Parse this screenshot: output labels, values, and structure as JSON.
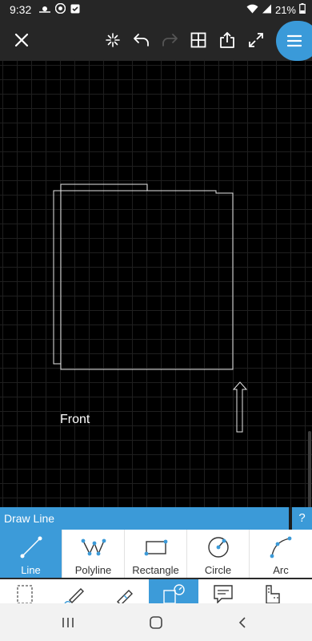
{
  "status_bar": {
    "time": "9:32",
    "battery": "21%",
    "left_icons": [
      "weather-icon",
      "chrome-icon",
      "download-icon"
    ],
    "right_icons": [
      "wifi-icon",
      "signal-icon",
      "battery-icon"
    ]
  },
  "toolbar": {
    "buttons": [
      "close-icon",
      "snap-icon",
      "undo-icon",
      "redo-icon",
      "grid-icon",
      "share-icon",
      "fullscreen-icon",
      "menu-icon"
    ]
  },
  "canvas": {
    "label": "Front"
  },
  "draw_panel": {
    "title": "Draw Line",
    "help": "?"
  },
  "tools": [
    {
      "label": "Line",
      "icon": "line-icon",
      "selected": true
    },
    {
      "label": "Polyline",
      "icon": "polyline-icon",
      "selected": false
    },
    {
      "label": "Rectangle",
      "icon": "rectangle-icon",
      "selected": false
    },
    {
      "label": "Circle",
      "icon": "circle-icon",
      "selected": false
    },
    {
      "label": "Arc",
      "icon": "arc-icon",
      "selected": false
    }
  ],
  "categories": [
    "select-icon",
    "sketch-icon",
    "markup-icon",
    "draw-icon",
    "annotate-icon",
    "measure-icon"
  ],
  "colors": {
    "accent": "#3b9ad8",
    "toolbar_bg": "#262626",
    "canvas_bg": "#000000"
  }
}
